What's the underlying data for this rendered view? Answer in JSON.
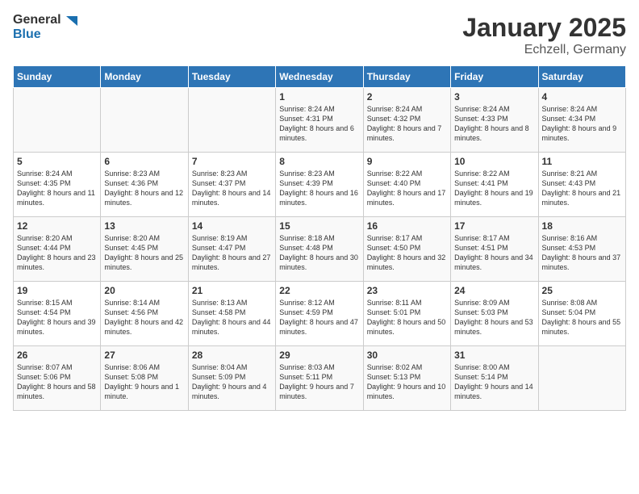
{
  "header": {
    "logo_general": "General",
    "logo_blue": "Blue",
    "month": "January 2025",
    "location": "Echzell, Germany"
  },
  "days_of_week": [
    "Sunday",
    "Monday",
    "Tuesday",
    "Wednesday",
    "Thursday",
    "Friday",
    "Saturday"
  ],
  "weeks": [
    [
      {
        "day": "",
        "content": ""
      },
      {
        "day": "",
        "content": ""
      },
      {
        "day": "",
        "content": ""
      },
      {
        "day": "1",
        "content": "Sunrise: 8:24 AM\nSunset: 4:31 PM\nDaylight: 8 hours\nand 6 minutes."
      },
      {
        "day": "2",
        "content": "Sunrise: 8:24 AM\nSunset: 4:32 PM\nDaylight: 8 hours\nand 7 minutes."
      },
      {
        "day": "3",
        "content": "Sunrise: 8:24 AM\nSunset: 4:33 PM\nDaylight: 8 hours\nand 8 minutes."
      },
      {
        "day": "4",
        "content": "Sunrise: 8:24 AM\nSunset: 4:34 PM\nDaylight: 8 hours\nand 9 minutes."
      }
    ],
    [
      {
        "day": "5",
        "content": "Sunrise: 8:24 AM\nSunset: 4:35 PM\nDaylight: 8 hours\nand 11 minutes."
      },
      {
        "day": "6",
        "content": "Sunrise: 8:23 AM\nSunset: 4:36 PM\nDaylight: 8 hours\nand 12 minutes."
      },
      {
        "day": "7",
        "content": "Sunrise: 8:23 AM\nSunset: 4:37 PM\nDaylight: 8 hours\nand 14 minutes."
      },
      {
        "day": "8",
        "content": "Sunrise: 8:23 AM\nSunset: 4:39 PM\nDaylight: 8 hours\nand 16 minutes."
      },
      {
        "day": "9",
        "content": "Sunrise: 8:22 AM\nSunset: 4:40 PM\nDaylight: 8 hours\nand 17 minutes."
      },
      {
        "day": "10",
        "content": "Sunrise: 8:22 AM\nSunset: 4:41 PM\nDaylight: 8 hours\nand 19 minutes."
      },
      {
        "day": "11",
        "content": "Sunrise: 8:21 AM\nSunset: 4:43 PM\nDaylight: 8 hours\nand 21 minutes."
      }
    ],
    [
      {
        "day": "12",
        "content": "Sunrise: 8:20 AM\nSunset: 4:44 PM\nDaylight: 8 hours\nand 23 minutes."
      },
      {
        "day": "13",
        "content": "Sunrise: 8:20 AM\nSunset: 4:45 PM\nDaylight: 8 hours\nand 25 minutes."
      },
      {
        "day": "14",
        "content": "Sunrise: 8:19 AM\nSunset: 4:47 PM\nDaylight: 8 hours\nand 27 minutes."
      },
      {
        "day": "15",
        "content": "Sunrise: 8:18 AM\nSunset: 4:48 PM\nDaylight: 8 hours\nand 30 minutes."
      },
      {
        "day": "16",
        "content": "Sunrise: 8:17 AM\nSunset: 4:50 PM\nDaylight: 8 hours\nand 32 minutes."
      },
      {
        "day": "17",
        "content": "Sunrise: 8:17 AM\nSunset: 4:51 PM\nDaylight: 8 hours\nand 34 minutes."
      },
      {
        "day": "18",
        "content": "Sunrise: 8:16 AM\nSunset: 4:53 PM\nDaylight: 8 hours\nand 37 minutes."
      }
    ],
    [
      {
        "day": "19",
        "content": "Sunrise: 8:15 AM\nSunset: 4:54 PM\nDaylight: 8 hours\nand 39 minutes."
      },
      {
        "day": "20",
        "content": "Sunrise: 8:14 AM\nSunset: 4:56 PM\nDaylight: 8 hours\nand 42 minutes."
      },
      {
        "day": "21",
        "content": "Sunrise: 8:13 AM\nSunset: 4:58 PM\nDaylight: 8 hours\nand 44 minutes."
      },
      {
        "day": "22",
        "content": "Sunrise: 8:12 AM\nSunset: 4:59 PM\nDaylight: 8 hours\nand 47 minutes."
      },
      {
        "day": "23",
        "content": "Sunrise: 8:11 AM\nSunset: 5:01 PM\nDaylight: 8 hours\nand 50 minutes."
      },
      {
        "day": "24",
        "content": "Sunrise: 8:09 AM\nSunset: 5:03 PM\nDaylight: 8 hours\nand 53 minutes."
      },
      {
        "day": "25",
        "content": "Sunrise: 8:08 AM\nSunset: 5:04 PM\nDaylight: 8 hours\nand 55 minutes."
      }
    ],
    [
      {
        "day": "26",
        "content": "Sunrise: 8:07 AM\nSunset: 5:06 PM\nDaylight: 8 hours\nand 58 minutes."
      },
      {
        "day": "27",
        "content": "Sunrise: 8:06 AM\nSunset: 5:08 PM\nDaylight: 9 hours\nand 1 minute."
      },
      {
        "day": "28",
        "content": "Sunrise: 8:04 AM\nSunset: 5:09 PM\nDaylight: 9 hours\nand 4 minutes."
      },
      {
        "day": "29",
        "content": "Sunrise: 8:03 AM\nSunset: 5:11 PM\nDaylight: 9 hours\nand 7 minutes."
      },
      {
        "day": "30",
        "content": "Sunrise: 8:02 AM\nSunset: 5:13 PM\nDaylight: 9 hours\nand 10 minutes."
      },
      {
        "day": "31",
        "content": "Sunrise: 8:00 AM\nSunset: 5:14 PM\nDaylight: 9 hours\nand 14 minutes."
      },
      {
        "day": "",
        "content": ""
      }
    ]
  ]
}
